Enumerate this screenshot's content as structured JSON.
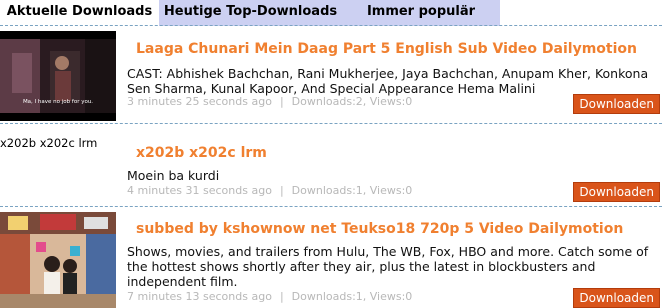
{
  "tabs": [
    {
      "label": "Aktuelle Downloads"
    },
    {
      "label": "Heutige Top-Downloads"
    },
    {
      "label": "Immer populär"
    }
  ],
  "items": [
    {
      "title": "Laaga Chunari Mein Daag Part 5 English Sub Video Dailymotion",
      "description": "CAST: Abhishek Bachchan, Rani Mukherjee, Jaya Bachchan, Anupam Kher, Konkona Sen Sharma, Kunal Kapoor, And Special Appearance Hema Malini",
      "time": "3 minutes 25 seconds ago",
      "stats": "Downloads:2, Views:0",
      "button": "Downloaden",
      "thumb_subtitle": "Ma, I have no job for you."
    },
    {
      "title": "x202b x202c lrm",
      "thumb_alt": "x202b x202c lrm",
      "description": "Moein ba kurdi",
      "time": "4 minutes 31 seconds ago",
      "stats": "Downloads:1, Views:0",
      "button": "Downloaden"
    },
    {
      "title": "subbed by kshownow net Teukso18 720p 5 Video Dailymotion",
      "description": "Shows, movies, and trailers from Hulu, The WB, Fox, HBO and more. Catch some of the hottest shows shortly after they air, plus the latest in blockbusters and independent film.",
      "time": "7 minutes 13 seconds ago",
      "stats": "Downloads:1, Views:0",
      "button": "Downloaden"
    }
  ]
}
